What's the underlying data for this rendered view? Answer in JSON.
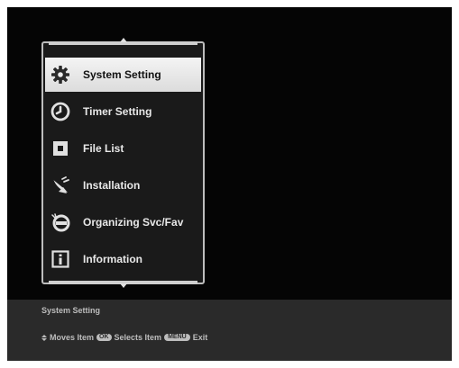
{
  "menu": {
    "items": [
      {
        "label": "System Setting",
        "icon": "gear-icon",
        "selected": true
      },
      {
        "label": "Timer Setting",
        "icon": "clock-icon",
        "selected": false
      },
      {
        "label": "File List",
        "icon": "square-dot-icon",
        "selected": false
      },
      {
        "label": "Installation",
        "icon": "satellite-dish-icon",
        "selected": false
      },
      {
        "label": "Organizing Svc/Fav",
        "icon": "no-entry-icon",
        "selected": false
      },
      {
        "label": "Information",
        "icon": "info-icon",
        "selected": false
      }
    ]
  },
  "info_bar": {
    "title": "System Setting",
    "help": {
      "moves_label": "Moves Item",
      "ok_key": "OK",
      "selects_label": "Selects Item",
      "menu_key": "MENU",
      "exit_label": "Exit"
    }
  },
  "colors": {
    "screen_bg": "#050505",
    "panel_bg": "#1a1a1a",
    "selected_bg": "#eeeeee",
    "info_bar_bg": "#2a2a2a",
    "text_light": "#e8e8e8",
    "text_dark": "#111111"
  }
}
